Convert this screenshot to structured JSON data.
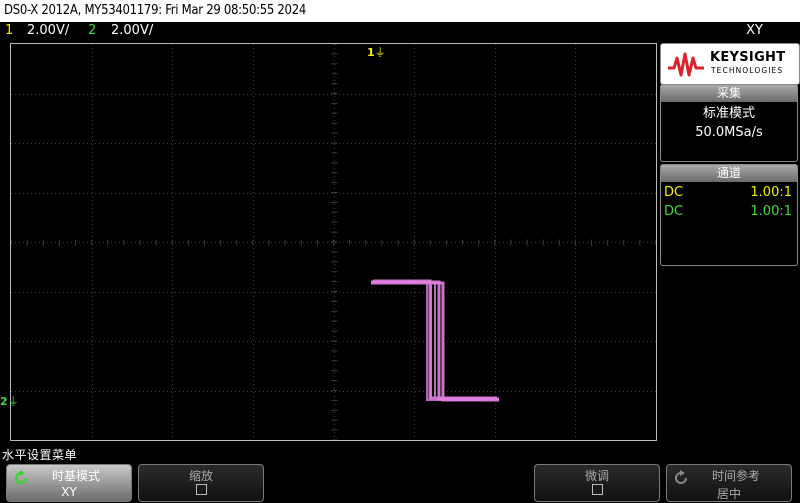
{
  "header": {
    "title": "DS0-X 2012A, MY53401179: Fri Mar 29 08:50:55 2024"
  },
  "channels": [
    {
      "num": "1",
      "scale": "2.00V/",
      "color": "#f4f000"
    },
    {
      "num": "2",
      "scale": "2.00V/",
      "color": "#3bdc3b"
    }
  ],
  "mode_label": "XY",
  "markers": {
    "ch1_marker": "1",
    "ch2_marker": "2"
  },
  "brand": {
    "name": "KEYSIGHT",
    "sub": "TECHNOLOGIES"
  },
  "acquire": {
    "header": "采集",
    "mode": "标准模式",
    "rate": "50.0MSa/s"
  },
  "channel_panel": {
    "header": "通道",
    "rows": [
      {
        "coupling": "DC",
        "ratio": "1.00:1",
        "color": "#f4f000"
      },
      {
        "coupling": "DC",
        "ratio": "1.00:1",
        "color": "#3bdc3b"
      }
    ]
  },
  "menu": {
    "title": "水平设置菜单",
    "keys": [
      {
        "label": "时基模式",
        "value": "XY",
        "active": true
      },
      {
        "label": "缩放",
        "value": "",
        "checkbox": true
      },
      {
        "label": "微调",
        "value": "",
        "checkbox": true
      },
      {
        "label": "时间参考",
        "value": "居中"
      }
    ]
  },
  "colors": {
    "trace": "#e07fe0",
    "grid": "#3c3c3c",
    "ch1": "#f4f000",
    "ch2": "#3bdc3b"
  }
}
